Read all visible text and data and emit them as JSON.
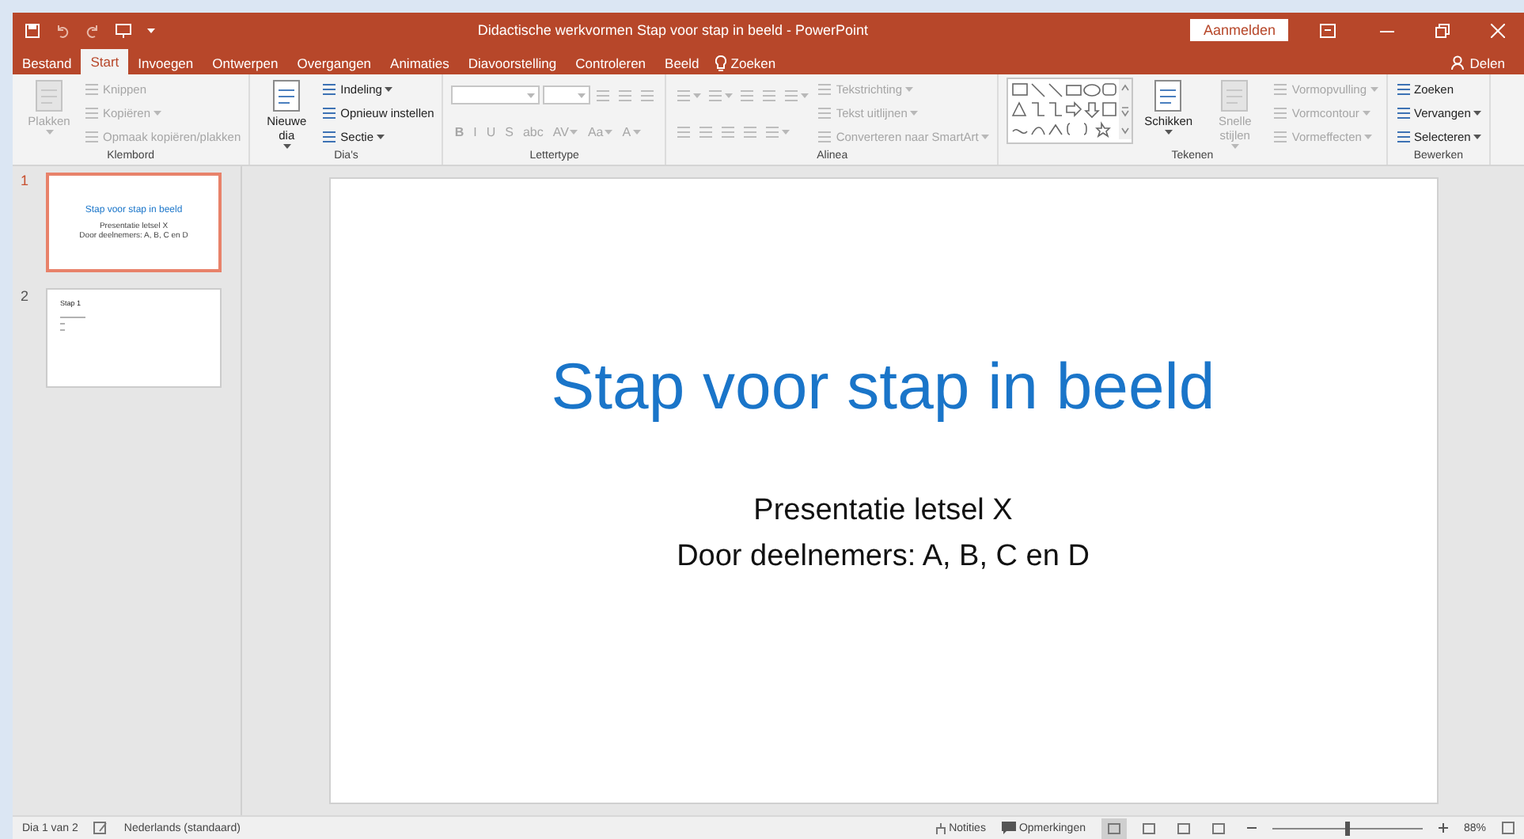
{
  "title_bar": {
    "title": "Didactische werkvormen Stap voor stap in beeld  -  PowerPoint",
    "signin": "Aanmelden"
  },
  "tabs": [
    {
      "label": "Bestand",
      "selected": false
    },
    {
      "label": "Start",
      "selected": true
    },
    {
      "label": "Invoegen",
      "selected": false
    },
    {
      "label": "Ontwerpen",
      "selected": false
    },
    {
      "label": "Overgangen",
      "selected": false
    },
    {
      "label": "Animaties",
      "selected": false
    },
    {
      "label": "Diavoorstelling",
      "selected": false
    },
    {
      "label": "Controleren",
      "selected": false
    },
    {
      "label": "Beeld",
      "selected": false
    }
  ],
  "tell_me": "Zoeken",
  "share": "Delen",
  "ribbon": [
    {
      "label": "Klembord",
      "columns": [
        [
          [
            {
              "kind": "large",
              "label": "Plakken",
              "disabled": true,
              "dropdown": true
            }
          ]
        ],
        [
          [
            {
              "kind": "small",
              "label": "Knippen",
              "disabled": true
            }
          ],
          [
            {
              "kind": "small",
              "label": "Kopiëren",
              "disabled": true,
              "dropdown": true
            }
          ],
          [
            {
              "kind": "small",
              "label": "Opmaak kopiëren/plakken",
              "disabled": true
            }
          ]
        ]
      ]
    },
    {
      "label": "Dia's",
      "columns": [
        [
          [
            {
              "kind": "large",
              "label": "Nieuwe dia",
              "disabled": false,
              "dropdown": true
            }
          ]
        ],
        [
          [
            {
              "kind": "small",
              "label": "Indeling",
              "disabled": false,
              "dropdown": true
            }
          ],
          [
            {
              "kind": "small",
              "label": "Opnieuw instellen",
              "disabled": false
            }
          ],
          [
            {
              "kind": "small",
              "label": "Sectie",
              "disabled": false,
              "dropdown": true
            }
          ]
        ]
      ]
    },
    {
      "label": "Lettertype",
      "columns": [
        [
          [
            {
              "kind": "field",
              "disabled": true,
              "dropdown": true
            },
            {
              "kind": "field",
              "disabled": true,
              "dropdown": true
            },
            {
              "kind": "icon",
              "disabled": true
            },
            {
              "kind": "icon",
              "disabled": true
            },
            {
              "kind": "icon",
              "disabled": true
            }
          ],
          [
            {
              "kind": "glyph",
              "label": "B",
              "disabled": true
            },
            {
              "kind": "glyph",
              "label": "I",
              "disabled": true
            },
            {
              "kind": "glyph",
              "label": "U",
              "disabled": true
            },
            {
              "kind": "glyph",
              "label": "S",
              "disabled": true
            },
            {
              "kind": "glyph",
              "label": "abc",
              "disabled": true
            },
            {
              "kind": "glyph",
              "label": "AV",
              "disabled": true,
              "dropdown": true
            },
            {
              "kind": "glyph",
              "label": "Aa",
              "disabled": true,
              "dropdown": true
            },
            {
              "kind": "glyph",
              "label": "A",
              "disabled": true,
              "dropdown": true
            }
          ]
        ]
      ]
    },
    {
      "label": "Alinea",
      "columns": [
        [
          [
            {
              "kind": "icon",
              "disabled": true,
              "dropdown": true
            },
            {
              "kind": "icon",
              "disabled": true,
              "dropdown": true
            },
            {
              "kind": "icon",
              "disabled": true
            },
            {
              "kind": "icon",
              "disabled": true
            },
            {
              "kind": "icon",
              "disabled": true,
              "dropdown": true
            }
          ],
          [
            {
              "kind": "icon",
              "disabled": true
            },
            {
              "kind": "icon",
              "disabled": true
            },
            {
              "kind": "icon",
              "disabled": true
            },
            {
              "kind": "icon",
              "disabled": true
            },
            {
              "kind": "icon",
              "disabled": true,
              "dropdown": true
            }
          ]
        ],
        [
          [
            {
              "kind": "small",
              "label": "Tekstrichting",
              "disabled": true,
              "dropdown": true
            }
          ],
          [
            {
              "kind": "small",
              "label": "Tekst uitlijnen",
              "disabled": true,
              "dropdown": true
            }
          ],
          [
            {
              "kind": "small",
              "label": "Converteren naar SmartArt",
              "disabled": true,
              "dropdown": true
            }
          ]
        ]
      ]
    },
    {
      "label": "Tekenen",
      "columns": [
        [
          [
            {
              "kind": "gallery",
              "disabled": false
            }
          ]
        ],
        [
          [
            {
              "kind": "large",
              "label": "Schikken",
              "disabled": false,
              "dropdown": true
            }
          ]
        ],
        [
          [
            {
              "kind": "large",
              "label": "Snelle stijlen",
              "disabled": true,
              "dropdown": true
            }
          ]
        ],
        [
          [
            {
              "kind": "small",
              "label": "Vormopvulling",
              "disabled": true,
              "dropdown": true
            }
          ],
          [
            {
              "kind": "small",
              "label": "Vormcontour",
              "disabled": true,
              "dropdown": true
            }
          ],
          [
            {
              "kind": "small",
              "label": "Vormeffecten",
              "disabled": true,
              "dropdown": true
            }
          ]
        ]
      ]
    },
    {
      "label": "Bewerken",
      "columns": [
        [
          [
            {
              "kind": "small",
              "label": "Zoeken",
              "disabled": false
            }
          ],
          [
            {
              "kind": "small",
              "label": "Vervangen",
              "disabled": false,
              "dropdown": true
            }
          ],
          [
            {
              "kind": "small",
              "label": "Selecteren",
              "disabled": false,
              "dropdown": true
            }
          ]
        ]
      ]
    }
  ],
  "slides": [
    {
      "number": "1",
      "selected": true,
      "kind": "title",
      "title": "Stap voor stap in beeld",
      "lines": [
        "Presentatie letsel X",
        "Door deelnemers: A, B, C en D"
      ]
    },
    {
      "number": "2",
      "selected": false,
      "kind": "content",
      "title": "Stap 1"
    }
  ],
  "current_slide": {
    "title": "Stap voor stap in beeld",
    "lines": [
      "Presentatie letsel X",
      "Door deelnemers: A, B, C en D"
    ]
  },
  "status_bar": {
    "slide_info": "Dia 1 van 2",
    "language": "Nederlands (standaard)",
    "notes": "Notities",
    "comments": "Opmerkingen",
    "views": [
      {
        "selected": true
      },
      {
        "selected": false
      },
      {
        "selected": false
      },
      {
        "selected": false
      }
    ],
    "zoom": {
      "level": 0.5,
      "reading": "88%"
    }
  }
}
